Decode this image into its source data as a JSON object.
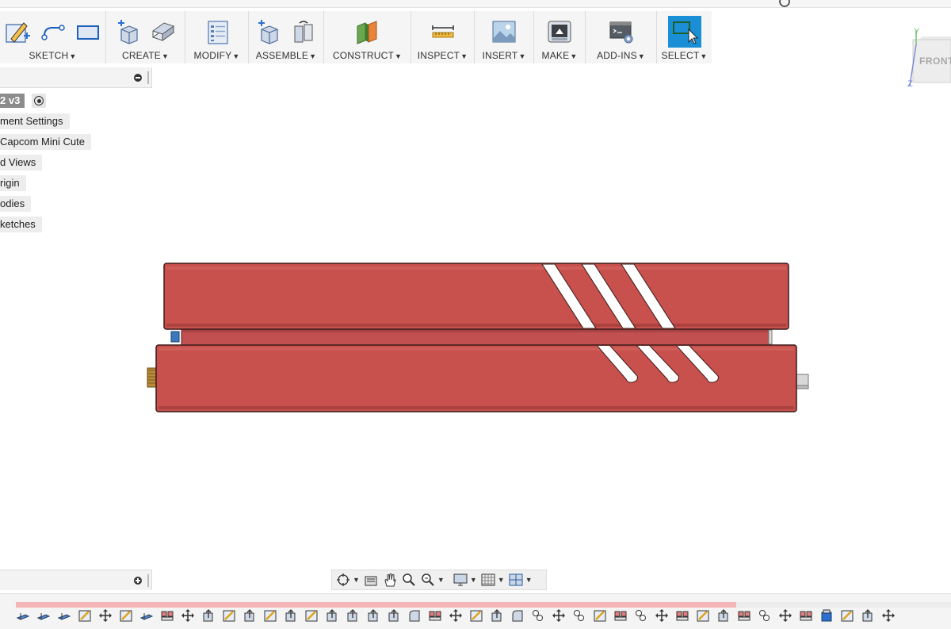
{
  "toolbar": {
    "groups": [
      {
        "key": "sketch",
        "label": "SKETCH",
        "icons": [
          "create-sketch-icon",
          "line-icon",
          "rectangle-icon"
        ]
      },
      {
        "key": "create",
        "label": "CREATE",
        "icons": [
          "new-component-icon",
          "extrude-icon"
        ]
      },
      {
        "key": "modify",
        "label": "MODIFY",
        "icons": [
          "parameters-icon"
        ]
      },
      {
        "key": "assemble",
        "label": "ASSEMBLE",
        "icons": [
          "new-component-assemble-icon",
          "joint-icon"
        ]
      },
      {
        "key": "construct",
        "label": "CONSTRUCT",
        "icons": [
          "offset-plane-icon"
        ]
      },
      {
        "key": "inspect",
        "label": "INSPECT",
        "icons": [
          "measure-icon"
        ]
      },
      {
        "key": "insert",
        "label": "INSERT",
        "icons": [
          "insert-image-icon"
        ]
      },
      {
        "key": "make",
        "label": "MAKE",
        "icons": [
          "3d-print-icon"
        ]
      },
      {
        "key": "addins",
        "label": "ADD-INS",
        "icons": [
          "scripts-icon"
        ]
      },
      {
        "key": "select",
        "label": "SELECT",
        "icons": [
          "select-icon"
        ]
      }
    ]
  },
  "viewcube": {
    "face": "FRONT",
    "axis_y": "Y",
    "axis_z": "Z"
  },
  "browser": {
    "document_badge": "2 v3",
    "items": [
      "ment Settings",
      "Capcom Mini Cute",
      "d Views",
      "rigin",
      "odies",
      "ketches"
    ]
  },
  "timeline": {
    "progress": 0.77,
    "icon_kinds": [
      "plane",
      "plane",
      "plane",
      "sketch",
      "move",
      "sketch",
      "plane",
      "feature",
      "move",
      "extrude",
      "sketch",
      "extrude",
      "sketch",
      "extrude",
      "sketch",
      "extrude",
      "extrude",
      "extrude",
      "extrude",
      "fillet",
      "feature",
      "move",
      "sketch",
      "extrude",
      "fillet",
      "joint",
      "move",
      "joint",
      "sketch",
      "feature",
      "joint",
      "move",
      "feature",
      "sketch",
      "extrude",
      "feature",
      "joint",
      "move",
      "feature",
      "component",
      "sketch",
      "extrude",
      "move"
    ]
  },
  "colors": {
    "body_red": "#c8504d",
    "body_edge": "#5a2a28",
    "select_active": "#1a8fd6",
    "construct_green": "#6aa84f",
    "construct_orange": "#e8853a"
  }
}
